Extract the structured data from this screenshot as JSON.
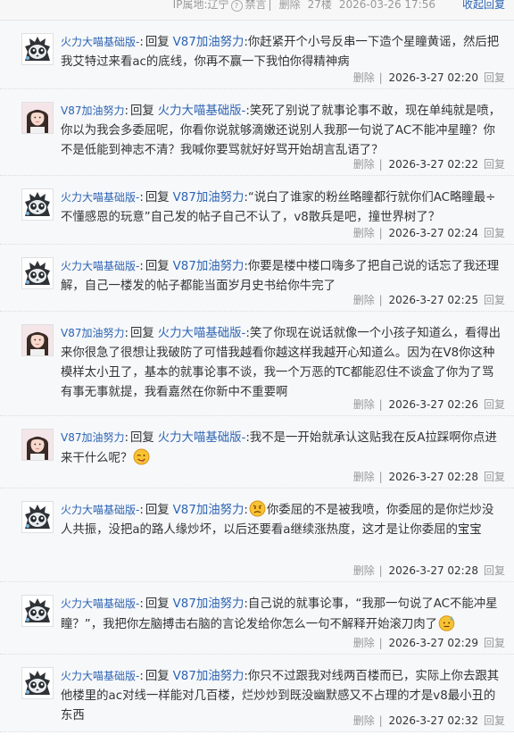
{
  "thread_meta": {
    "location": "IP属地:辽宁",
    "help_icon": "question-circle-icon",
    "ban_label": "禁言",
    "delete_label": "删除",
    "floor": "27楼",
    "time": "2026-03-26 17:56",
    "collapse_label": "收起回复"
  },
  "colors": {
    "link": "#2d64b3",
    "text": "#333333",
    "muted": "#999999",
    "bg": "#f7f8fa"
  },
  "replies": [
    {
      "avatar": "panda-avatar",
      "user": "火力大喵基础版-",
      "sep": ":",
      "reply_word": "回复",
      "target": "V87加油努力",
      "text": ":你赶紧开个小号反串一下造个星瞳黄谣，然后把我艾特过来看ac的底线，你再不赢一下我怕你得精神病",
      "delete_label": "删除",
      "time": "2026-3-27 02:20",
      "reply_label": "回复"
    },
    {
      "avatar": "girl-avatar",
      "user": "V87加油努力",
      "sep": ":",
      "reply_word": "回复",
      "target": "火力大喵基础版-",
      "text": ":笑死了别说了就事论事不敢，现在单纯就是喷，你以为我会多委屈呢，你看你说就够滴嫩还说别人我那一句说了AC不能冲星瞳？你不是低能到神志不清？我喊你要骂就好好骂开始胡言乱语了？",
      "delete_label": "删除",
      "time": "2026-3-27 02:22",
      "reply_label": "回复"
    },
    {
      "avatar": "panda-avatar",
      "user": "火力大喵基础版-",
      "sep": ":",
      "reply_word": "回复",
      "target": "V87加油努力",
      "text": ":“说白了谁家的粉丝略瞳都行就你们AC略瞳最÷不懂感恩的玩意”自己发的帖子自己不认了，v8散兵是吧，撞世界树了？",
      "delete_label": "删除",
      "time": "2026-3-27 02:24",
      "reply_label": "回复"
    },
    {
      "avatar": "panda-avatar",
      "user": "火力大喵基础版-",
      "sep": ":",
      "reply_word": "回复",
      "target": "V87加油努力",
      "text": ":你要是楼中楼口嗨多了把自己说的话忘了我还理解，自己一楼发的帖子都能当面岁月史书给你牛完了",
      "delete_label": "删除",
      "time": "2026-3-27 02:25",
      "reply_label": "回复"
    },
    {
      "avatar": "girl-avatar",
      "user": "V87加油努力",
      "sep": ":",
      "reply_word": "回复",
      "target": "火力大喵基础版-",
      "text": ":笑了你现在说话就像一个小孩子知道么，看得出来你很急了很想让我破防了可惜我越看你越这样我越开心知道么。因为在V8你这种模样太小丑了，基本的就事论事不谈，我一个万恶的TC都能忍住不谈盒了你为了骂有事无事就提，我看嘉然在你新中不重要啊",
      "delete_label": "删除",
      "time": "2026-3-27 02:26",
      "reply_label": "回复"
    },
    {
      "avatar": "girl-avatar",
      "user": "V87加油努力",
      "sep": ":",
      "reply_word": "回复",
      "target": "火力大喵基础版-",
      "text": ":我不是一开始就承认这贴我在反A拉踩啊你点进来干什么呢？",
      "emoji_after": "tongue-emoji",
      "delete_label": "删除",
      "time": "2026-3-27 02:28",
      "reply_label": "回复"
    },
    {
      "avatar": "panda-avatar",
      "user": "火力大喵基础版-",
      "sep": ":",
      "reply_word": "回复",
      "target": "V87加油努力",
      "text_pre": ":",
      "emoji_mid": "angry-emoji",
      "text": "你委屈的不是被我喷，你委屈的是你烂炒没人共振，没把a的路人缘炒坏，以后还要看a继续涨热度，这才是让你委屈的宝宝",
      "delete_label": "删除",
      "time": "2026-3-27 02:28",
      "reply_label": "回复"
    },
    {
      "avatar": "panda-avatar",
      "user": "火力大喵基础版-",
      "sep": ":",
      "reply_word": "回复",
      "target": "V87加油努力",
      "text": ":自己说的就事论事，“我那一句说了AC不能冲星瞳？”，我把你左脑搏击右脑的言论发给你怎么一句不解释开始滚刀肉了",
      "emoji_after": "sweat-emoji",
      "delete_label": "删除",
      "time": "2026-3-27 02:29",
      "reply_label": "回复"
    },
    {
      "avatar": "panda-avatar",
      "user": "火力大喵基础版-",
      "sep": ":",
      "reply_word": "回复",
      "target": "V87加油努力",
      "text": ":你只不过跟我对线两百楼而已，实际上你去跟其他楼里的ac对线一样能对几百楼，烂炒炒到既没幽默感又不占理的才是v8最小丑的东西",
      "delete_label": "删除",
      "time": "2026-3-27 02:32",
      "reply_label": "回复"
    }
  ]
}
